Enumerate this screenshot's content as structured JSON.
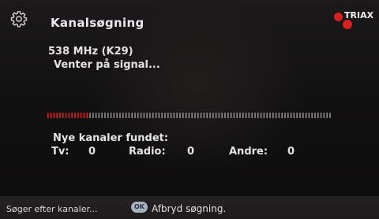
{
  "header": {
    "title": "Kanalsøgning",
    "brand": "TRIAX",
    "icon": "gear-icon"
  },
  "scan": {
    "frequency": "538 MHz (K29)",
    "status": "Venter på signal...",
    "progress_fraction": 0.15,
    "found_label": "Nye kanaler fundet:",
    "tv_label": "Tv:",
    "tv_count": "0",
    "radio_label": "Radio:",
    "radio_count": "0",
    "other_label": "Andre:",
    "other_count": "0"
  },
  "footer": {
    "status_text": "Søger efter kanaler...",
    "ok_label": "OK",
    "cancel_text": "Afbryd søgning."
  },
  "colors": {
    "accent_red": "#d6201f",
    "progress_unfilled": "#8e8a8e"
  }
}
